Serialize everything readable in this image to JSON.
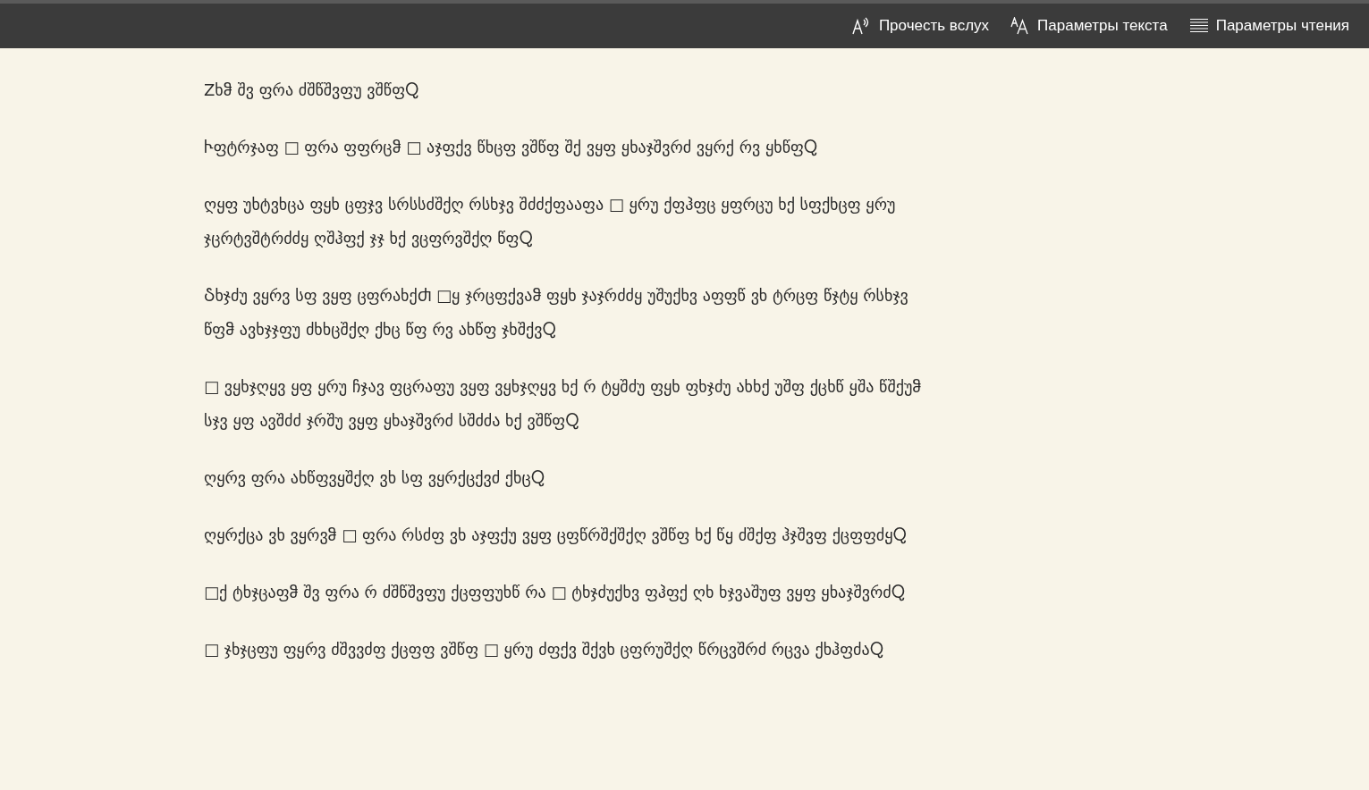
{
  "toolbar": {
    "buttons": [
      {
        "kind": "read_aloud",
        "label": "Прочесть вслух"
      },
      {
        "kind": "text_options",
        "label": "Параметры текста"
      },
      {
        "kind": "reading_options",
        "label": "Параметры чтения"
      }
    ]
  },
  "article": {
    "paragraphs": [
      "Zხჵ შვ ფრა ძშწშვფუ ვშწფႭ",
      "Ⴡფტრჯაფ □ ფრა ფფრცჵ □ აჯფქვ წხცფ ვშწფ შქ ვყფ ყხაჯშვრძ ვყრქ რვ ყხწფႭ",
      "ღყფ უხტვხცა ფყხ ცფჯვ სრსსძშქღ რსხჯვ შძძქფააფა □ ყრუ ქფჰფც ყფრცუ ხქ სფქხცფ ყრუ ჯცრტვშტრძძყ ღშჰფქ ჯჯ ხქ ვცფრვშქღ წფႭ",
      "Ⴢხჯძუ ვყრვ სფ ვყფ ცფრახქႻ □ყ ჯრცფქვაჵ ფყხ ჯაჯრძძყ უშუქხვ აფფწ ვხ ტრცფ წჯტყ რსხჯვ წფჵ ავხჯჯფუ ძხხცშქღ ქხც წფ რვ ახწფ ჯხშქვႭ",
      "□ ვყხჯღყვ ყფ ყრუ ჩჯავ ფცრაფუ ვყფ ვყხჯღყვ ხქ რ ტყშძუ ფყხ ფხჯძუ ახხქ უშფ ქცხწ ყშა წშქუჵ სჯვ ყფ ავშძძ ჯრშუ ვყფ ყხაჯშვრძ სშძძა ხქ ვშწფႭ",
      "ღყრვ ფრა ახწფვყშქღ ვხ სფ ვყრქცქვძ ქხცႭ",
      "ღყრქცა ვხ ვყრვჵ □ ფრა რსძფ ვხ აჯფქუ ვყფ ცფწრშქშქღ ვშწფ ხქ წყ ძშქფ ჰჯშვფ ქცფფძყႭ",
      "□ქ ტხჯცაფჵ შვ ფრა რ ძშწშვფუ ქცფფუხწ რა □ ტხჯძუქხვ ფჰფქ ღხ ხჯვაშუფ ვყფ ყხაჯშვრძႭ",
      "□ ჯხჯცფუ ფყრვ ძშვვძფ ქცფფ ვშწფ □ ყრუ ძფქვ შქვხ ცფრუშქღ წრცვშრძ რცვა ქხჰფძაႭ"
    ]
  }
}
